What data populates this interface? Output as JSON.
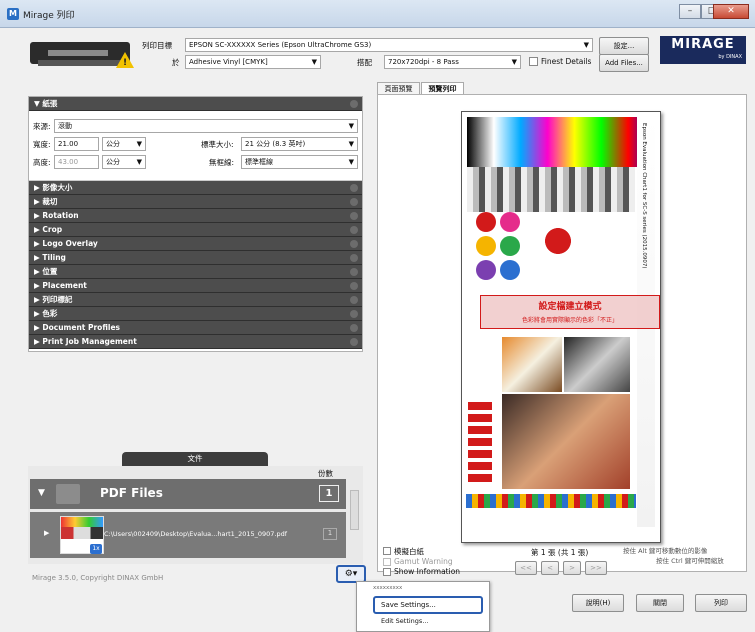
{
  "window": {
    "title": "Mirage 列印",
    "app_icon": "M"
  },
  "printer": {
    "target_label": "列印目標",
    "target_value": "EPSON SC-XXXXXX Series (Epson UltraChrome GS3)",
    "settings_button": "設定...",
    "media_label": "於",
    "media_value": "Adhesive Vinyl [CMYK]",
    "quality_label": "搭配",
    "quality_value": "720x720dpi - 8 Pass",
    "finest_details_label": "Finest Details",
    "add_files_button": "Add Files..."
  },
  "logo": {
    "text": "MIRAGE",
    "sub": "by DINAX"
  },
  "paper": {
    "header": "紙張",
    "source_label": "來源:",
    "source_value": "滾動",
    "width_label": "寬度:",
    "width_value": "21.00",
    "width_unit": "公分",
    "height_label": "高度:",
    "height_value": "43.00",
    "height_unit": "公分",
    "std_size_label": "標準大小:",
    "std_size_value": "21 公分 (8.3 英吋)",
    "border_label": "無框線:",
    "border_value": "標準框線"
  },
  "sections": [
    "影像大小",
    "裁切",
    "Rotation",
    "Crop",
    "Logo Overlay",
    "Tiling",
    "位置",
    "Placement",
    "列印標記",
    "色彩",
    "Document Profiles",
    "Print Job Management"
  ],
  "documents": {
    "tab_label": "文件",
    "copies_label": "份數",
    "folder_title": "PDF Files",
    "folder_count": "1",
    "file_path": "C:\\Users\\002409\\Desktop\\Evalua...hart1_2015_0907.pdf",
    "file_badge": "1x",
    "file_copies": "1"
  },
  "copyright": "Mirage 3.5.0, Copyright DINAX GmbH",
  "preview_tabs": [
    "頁面預覽",
    "預覽列印"
  ],
  "preview": {
    "chart_title": "Epson Evaluation Chart1 for SC-S series (2015.0907)",
    "banner_title": "設定檔建立模式",
    "banner_sub": "色彩將會用實際顯示的色彩「不正」",
    "color_swatch_blue": "#2b6fd0",
    "color_accent": "#d21a1a"
  },
  "options": {
    "simulate_paper_white": "模擬白紙",
    "gamut_warning": "Gamut Warning",
    "show_information": "Show Information"
  },
  "paging": {
    "page_info": "第 1 張 (共 1 張)",
    "hint1": "按住 Alt 鍵可移動數位的影像",
    "hint2": "按住 Ctrl 鍵可伸開縮放",
    "first": "<<",
    "prev": "<",
    "next": ">",
    "last": ">>"
  },
  "buttons": {
    "help": "說明(H)",
    "close": "關閉",
    "print": "列印"
  },
  "context_menu": {
    "item_top": "xxxxxxxxx",
    "save_settings": "Save Settings...",
    "edit_settings": "Edit Settings..."
  }
}
